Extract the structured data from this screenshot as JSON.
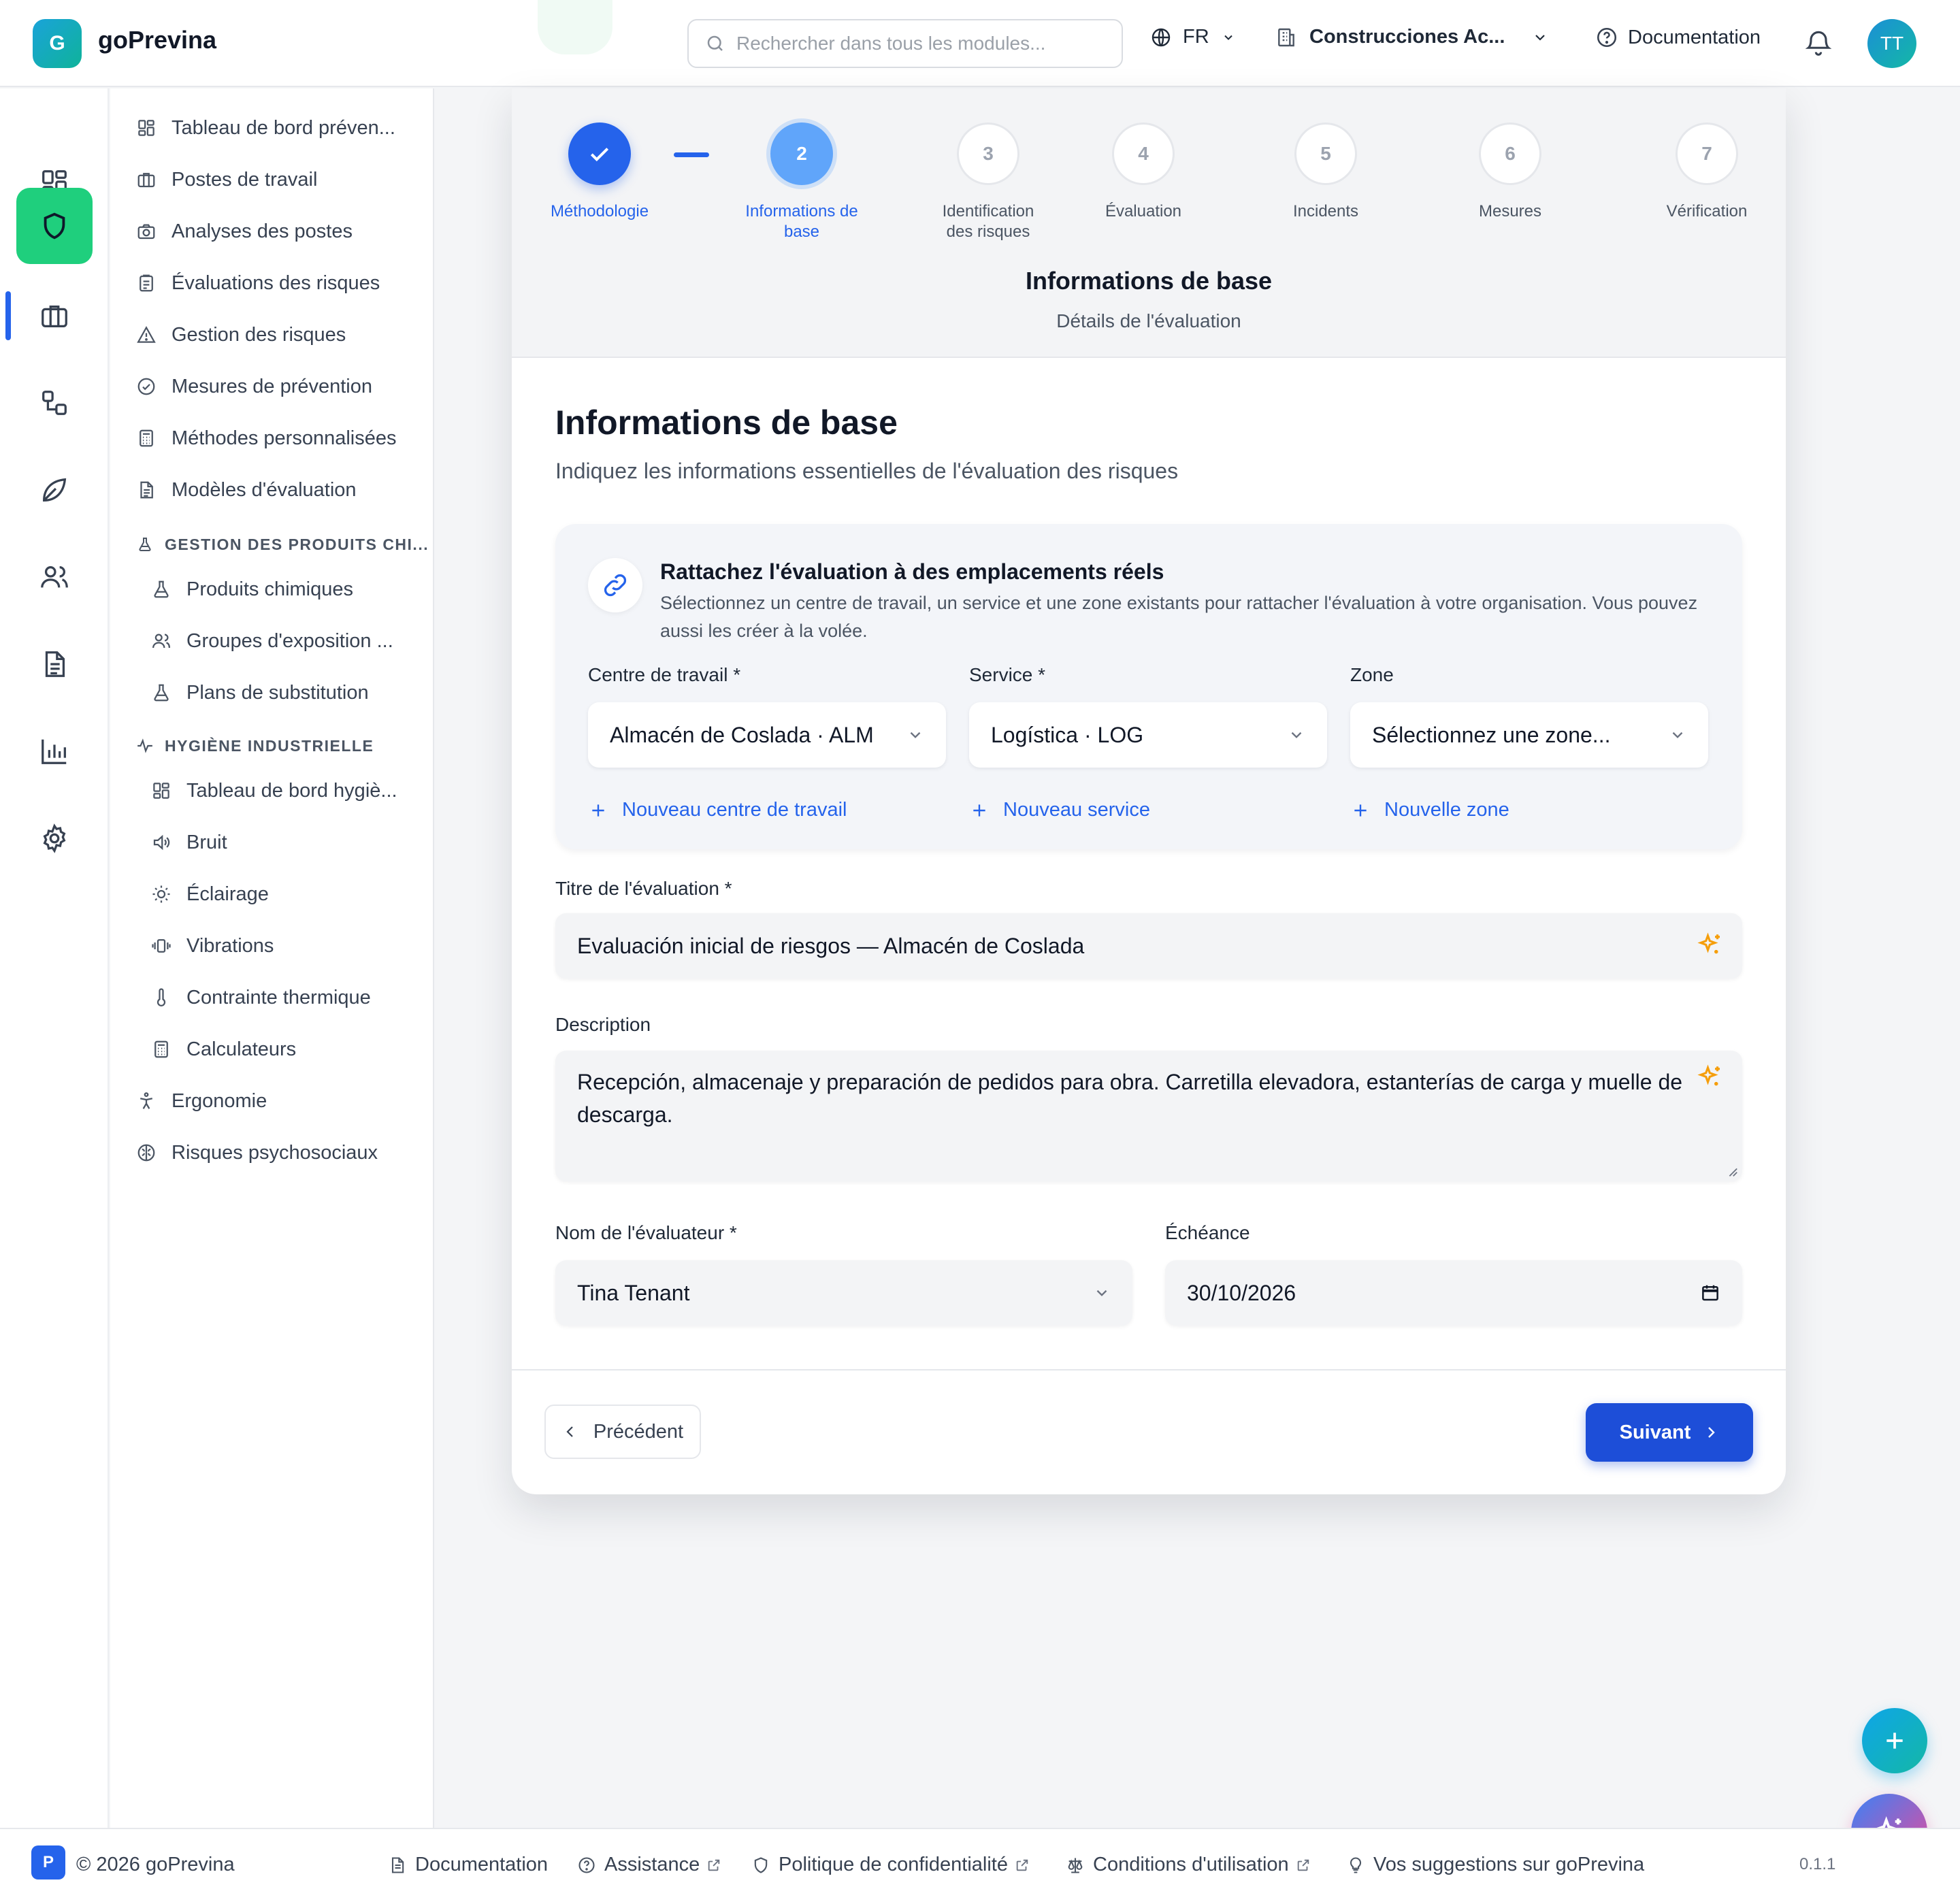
{
  "app": {
    "logo_letter": "G",
    "name": "goPrevina"
  },
  "header": {
    "search_placeholder": "Rechercher dans tous les modules...",
    "language": "FR",
    "organization": "Construcciones Ac...",
    "documentation": "Documentation",
    "avatar_initials": "TT"
  },
  "rail": {
    "items": [
      "dashboard-icon",
      "shield-icon",
      "briefcase-icon",
      "workflow-icon",
      "leaf-icon",
      "users-icon",
      "document-icon",
      "bar-chart-icon",
      "gear-icon"
    ],
    "active_index": 1,
    "active_color": "#1fcf7d"
  },
  "sidebar": {
    "items": [
      "Tableau de bord préven...",
      "Postes de travail",
      "Analyses des postes",
      "Évaluations des risques",
      "Gestion des risques",
      "Mesures de prévention",
      "Méthodes personnalisées",
      "Modèles d'évaluation"
    ],
    "chem_section": "GESTION DES PRODUITS CHI...",
    "chem_items": [
      "Produits chimiques",
      "Groupes d'exposition ...",
      "Plans de substitution"
    ],
    "hyg_section": "HYGIÈNE INDUSTRIELLE",
    "hyg_items": [
      "Tableau de bord hygiè...",
      "Bruit",
      "Éclairage",
      "Vibrations",
      "Contrainte thermique",
      "Calculateurs"
    ],
    "bottom_items": [
      "Ergonomie",
      "Risques psychosociaux"
    ]
  },
  "stepper": {
    "steps": [
      {
        "number": "1",
        "label": "Méthodologie",
        "state": "done"
      },
      {
        "number": "2",
        "label": "Informations de base",
        "state": "current"
      },
      {
        "number": "3",
        "label": "Identification des risques",
        "state": "todo"
      },
      {
        "number": "4",
        "label": "Évaluation",
        "state": "todo"
      },
      {
        "number": "5",
        "label": "Incidents",
        "state": "todo"
      },
      {
        "number": "6",
        "label": "Mesures",
        "state": "todo"
      },
      {
        "number": "7",
        "label": "Vérification",
        "state": "todo"
      }
    ],
    "title": "Informations de base",
    "subtitle": "Détails de l'évaluation"
  },
  "form": {
    "title": "Informations de base",
    "subtitle": "Indiquez les informations essentielles de l'évaluation des risques",
    "link_box": {
      "title": "Rattachez l'évaluation à des emplacements réels",
      "description": "Sélectionnez un centre de travail, un service et une zone existants pour rattacher l'évaluation à votre organisation. Vous pouvez aussi les créer à la volée.",
      "workcenter_label": "Centre de travail *",
      "workcenter_value": "Almacén de Coslada · ALM",
      "workcenter_add": "Nouveau centre de travail",
      "service_label": "Service *",
      "service_value": "Logística · LOG",
      "service_add": "Nouveau service",
      "zone_label": "Zone",
      "zone_placeholder": "Sélectionnez une zone...",
      "zone_add": "Nouvelle zone"
    },
    "title_label": "Titre de l'évaluation *",
    "title_value": "Evaluación inicial de riesgos — Almacén de Coslada",
    "description_label": "Description",
    "description_value": "Recepción, almacenaje y preparación de pedidos para obra. Carretilla elevadora, estanterías de carga y muelle de descarga.",
    "evaluator_label": "Nom de l'évaluateur *",
    "evaluator_value": "Tina Tenant",
    "due_label": "Échéance",
    "due_value": "30/10/2026",
    "prev_button": "Précédent",
    "next_button": "Suivant"
  },
  "footer": {
    "copyright": "© 2026 goPrevina",
    "badge": "P",
    "links": [
      "Documentation",
      "Assistance",
      "Politique de confidentialité",
      "Conditions d'utilisation",
      "Vos suggestions sur goPrevina"
    ],
    "version": "0.1.1"
  },
  "colors": {
    "primary": "#2563eb",
    "accent_green": "#1fcf7d",
    "sparkle": "#f59e0b"
  }
}
